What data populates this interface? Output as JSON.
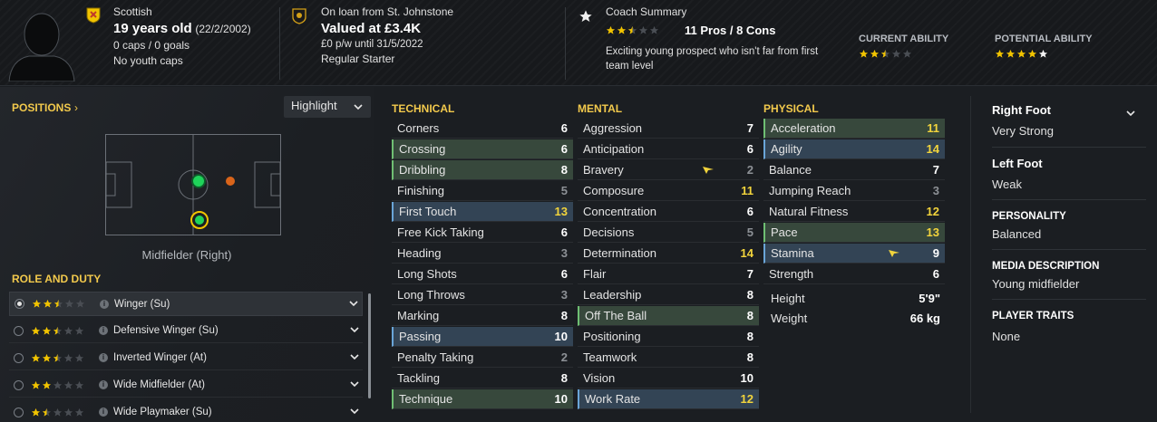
{
  "header": {
    "nationality": "Scottish",
    "age": "19 years old",
    "dob": "(22/2/2002)",
    "caps_goals": "0 caps / 0 goals",
    "youth_caps": "No youth caps",
    "loan": "On loan from St. Johnstone",
    "value": "Valued at £3.4K",
    "wage": "£0 p/w until 31/5/2022",
    "squad_status": "Regular Starter",
    "coach_summary_label": "Coach Summary",
    "pros_cons": "11 Pros / 8 Cons",
    "coach_text": "Exciting young prospect who isn't far from first team level",
    "coach_stars": 2.5,
    "current_ability_label": "CURRENT ABILITY",
    "current_ability_stars": 2.5,
    "potential_ability_label": "POTENTIAL ABILITY",
    "potential_ability_stars": 4.5
  },
  "positions": {
    "title": "POSITIONS",
    "highlight_label": "Highlight",
    "position_name": "Midfielder (Right)"
  },
  "roles": {
    "title": "ROLE AND DUTY",
    "items": [
      {
        "stars": 2.5,
        "label": "Winger (Su)",
        "selected": true
      },
      {
        "stars": 2.5,
        "label": "Defensive Winger (Su)",
        "selected": false
      },
      {
        "stars": 2.5,
        "label": "Inverted Winger (At)",
        "selected": false
      },
      {
        "stars": 2,
        "label": "Wide Midfielder (At)",
        "selected": false
      },
      {
        "stars": 1.5,
        "label": "Wide Playmaker (Su)",
        "selected": false
      }
    ]
  },
  "technical": {
    "title": "TECHNICAL",
    "rows": [
      {
        "name": "Corners",
        "value": "6",
        "style": ""
      },
      {
        "name": "Crossing",
        "value": "6",
        "style": "g"
      },
      {
        "name": "Dribbling",
        "value": "8",
        "style": "g"
      },
      {
        "name": "Finishing",
        "value": "5",
        "style": ""
      },
      {
        "name": "First Touch",
        "value": "13",
        "style": "b"
      },
      {
        "name": "Free Kick Taking",
        "value": "6",
        "style": ""
      },
      {
        "name": "Heading",
        "value": "3",
        "style": ""
      },
      {
        "name": "Long Shots",
        "value": "6",
        "style": ""
      },
      {
        "name": "Long Throws",
        "value": "3",
        "style": ""
      },
      {
        "name": "Marking",
        "value": "8",
        "style": ""
      },
      {
        "name": "Passing",
        "value": "10",
        "style": "b"
      },
      {
        "name": "Penalty Taking",
        "value": "2",
        "style": ""
      },
      {
        "name": "Tackling",
        "value": "8",
        "style": ""
      },
      {
        "name": "Technique",
        "value": "10",
        "style": "g"
      }
    ]
  },
  "mental": {
    "title": "MENTAL",
    "rows": [
      {
        "name": "Aggression",
        "value": "7",
        "style": ""
      },
      {
        "name": "Anticipation",
        "value": "6",
        "style": ""
      },
      {
        "name": "Bravery",
        "value": "2",
        "style": "",
        "arrow": true
      },
      {
        "name": "Composure",
        "value": "11",
        "style": ""
      },
      {
        "name": "Concentration",
        "value": "6",
        "style": ""
      },
      {
        "name": "Decisions",
        "value": "5",
        "style": ""
      },
      {
        "name": "Determination",
        "value": "14",
        "style": ""
      },
      {
        "name": "Flair",
        "value": "7",
        "style": ""
      },
      {
        "name": "Leadership",
        "value": "8",
        "style": ""
      },
      {
        "name": "Off The Ball",
        "value": "8",
        "style": "g"
      },
      {
        "name": "Positioning",
        "value": "8",
        "style": ""
      },
      {
        "name": "Teamwork",
        "value": "8",
        "style": ""
      },
      {
        "name": "Vision",
        "value": "10",
        "style": ""
      },
      {
        "name": "Work Rate",
        "value": "12",
        "style": "b"
      }
    ]
  },
  "physical": {
    "title": "PHYSICAL",
    "rows": [
      {
        "name": "Acceleration",
        "value": "11",
        "style": "g"
      },
      {
        "name": "Agility",
        "value": "14",
        "style": "b"
      },
      {
        "name": "Balance",
        "value": "7",
        "style": ""
      },
      {
        "name": "Jumping Reach",
        "value": "3",
        "style": ""
      },
      {
        "name": "Natural Fitness",
        "value": "12",
        "style": ""
      },
      {
        "name": "Pace",
        "value": "13",
        "style": "g"
      },
      {
        "name": "Stamina",
        "value": "9",
        "style": "b",
        "arrow": true
      },
      {
        "name": "Strength",
        "value": "6",
        "style": ""
      }
    ],
    "height_label": "Height",
    "height_value": "5'9\"",
    "weight_label": "Weight",
    "weight_value": "66 kg"
  },
  "details": {
    "right_foot_label": "Right Foot",
    "right_foot_value": "Very Strong",
    "left_foot_label": "Left Foot",
    "left_foot_value": "Weak",
    "personality_label": "PERSONALITY",
    "personality_value": "Balanced",
    "media_label": "MEDIA DESCRIPTION",
    "media_value": "Young midfielder",
    "traits_label": "PLAYER TRAITS",
    "traits_value": "None"
  },
  "colors": {
    "accent_yellow": "#f2c94c",
    "good_green": "#37483c",
    "good_blue": "#334455",
    "dot_green": "#1fd35a",
    "dot_orange": "#d9641a"
  }
}
